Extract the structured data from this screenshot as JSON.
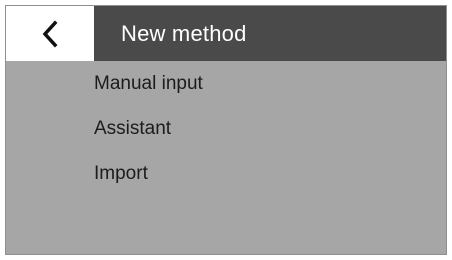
{
  "header": {
    "back_icon": "chevron-left-icon",
    "title": "New method"
  },
  "menu": {
    "items": [
      {
        "label": "Manual input"
      },
      {
        "label": "Assistant"
      },
      {
        "label": "Import"
      }
    ]
  },
  "colors": {
    "screen_background": "#a6a6a6",
    "title_bar": "#4a4a4a",
    "back_button_background": "#ffffff",
    "title_text": "#ffffff",
    "menu_text": "#1c1c1c"
  }
}
